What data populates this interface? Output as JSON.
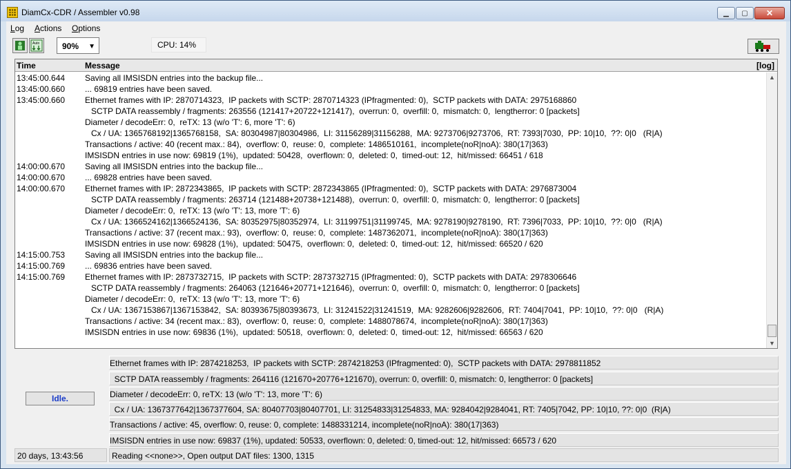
{
  "window": {
    "title": "DiamCx-CDR / Assembler  v0.98"
  },
  "menu": {
    "items": [
      "Log",
      "Actions",
      "Options"
    ]
  },
  "toolbar": {
    "zoom": "90%",
    "cpu": "CPU: 14%"
  },
  "log": {
    "headers": {
      "time": "Time",
      "message": "Message",
      "log": "[log]"
    },
    "lines": [
      {
        "time": "13:45:00.644",
        "msg": "Saving all IMSISDN entries into the backup file...",
        "indent": false
      },
      {
        "time": "13:45:00.660",
        "msg": "... 69819 entries have been saved.",
        "indent": false
      },
      {
        "time": "13:45:00.660",
        "msg": "Ethernet frames with IP: 2870714323,  IP packets with SCTP: 2870714323 (IPfragmented: 0),  SCTP packets with DATA: 2975168860",
        "indent": false
      },
      {
        "time": "",
        "msg": "SCTP DATA reassembly / fragments: 263556 (121417+20722+121417),  overrun: 0,  overfill: 0,  mismatch: 0,  lengtherror: 0 [packets]",
        "indent": true
      },
      {
        "time": "",
        "msg": "Diameter / decodeErr: 0,  reTX: 13 (w/o 'T': 6, more 'T': 6)",
        "indent": false
      },
      {
        "time": "",
        "msg": "Cx / UA: 1365768192|1365768158,  SA: 80304987|80304986,  LI: 31156289|31156288,  MA: 9273706|9273706,  RT: 7393|7030,  PP: 10|10,  ??: 0|0   (R|A)",
        "indent": true
      },
      {
        "time": "",
        "msg": "Transactions / active: 40 (recent max.: 84),  overflow: 0,  reuse: 0,  complete: 1486510161,  incomplete(noR|noA): 380(17|363)",
        "indent": false
      },
      {
        "time": "",
        "msg": "IMSISDN entries in use now: 69819 (1%),  updated: 50428,  overflown: 0,  deleted: 0,  timed-out: 12,  hit/missed: 66451 / 618",
        "indent": false
      },
      {
        "time": "14:00:00.670",
        "msg": "Saving all IMSISDN entries into the backup file...",
        "indent": false
      },
      {
        "time": "14:00:00.670",
        "msg": "... 69828 entries have been saved.",
        "indent": false
      },
      {
        "time": "14:00:00.670",
        "msg": "Ethernet frames with IP: 2872343865,  IP packets with SCTP: 2872343865 (IPfragmented: 0),  SCTP packets with DATA: 2976873004",
        "indent": false
      },
      {
        "time": "",
        "msg": "SCTP DATA reassembly / fragments: 263714 (121488+20738+121488),  overrun: 0,  overfill: 0,  mismatch: 0,  lengtherror: 0 [packets]",
        "indent": true
      },
      {
        "time": "",
        "msg": "Diameter / decodeErr: 0,  reTX: 13 (w/o 'T': 13, more 'T': 6)",
        "indent": false
      },
      {
        "time": "",
        "msg": "Cx / UA: 1366524162|1366524136,  SA: 80352975|80352974,  LI: 31199751|31199745,  MA: 9278190|9278190,  RT: 7396|7033,  PP: 10|10,  ??: 0|0   (R|A)",
        "indent": true
      },
      {
        "time": "",
        "msg": "Transactions / active: 37 (recent max.: 93),  overflow: 0,  reuse: 0,  complete: 1487362071,  incomplete(noR|noA): 380(17|363)",
        "indent": false
      },
      {
        "time": "",
        "msg": "IMSISDN entries in use now: 69828 (1%),  updated: 50475,  overflown: 0,  deleted: 0,  timed-out: 12,  hit/missed: 66520 / 620",
        "indent": false
      },
      {
        "time": "14:15:00.753",
        "msg": "Saving all IMSISDN entries into the backup file...",
        "indent": false
      },
      {
        "time": "14:15:00.769",
        "msg": "... 69836 entries have been saved.",
        "indent": false
      },
      {
        "time": "14:15:00.769",
        "msg": "Ethernet frames with IP: 2873732715,  IP packets with SCTP: 2873732715 (IPfragmented: 0),  SCTP packets with DATA: 2978306646",
        "indent": false
      },
      {
        "time": "",
        "msg": "SCTP DATA reassembly / fragments: 264063 (121646+20771+121646),  overrun: 0,  overfill: 0,  mismatch: 0,  lengtherror: 0 [packets]",
        "indent": true
      },
      {
        "time": "",
        "msg": "Diameter / decodeErr: 0,  reTX: 13 (w/o 'T': 13, more 'T': 6)",
        "indent": false
      },
      {
        "time": "",
        "msg": "Cx / UA: 1367153867|1367153842,  SA: 80393675|80393673,  LI: 31241522|31241519,  MA: 9282606|9282606,  RT: 7404|7041,  PP: 10|10,  ??: 0|0   (R|A)",
        "indent": true
      },
      {
        "time": "",
        "msg": "Transactions / active: 34 (recent max.: 83),  overflow: 0,  reuse: 0,  complete: 1488078674,  incomplete(noR|noA): 380(17|363)",
        "indent": false
      },
      {
        "time": "",
        "msg": "IMSISDN entries in use now: 69836 (1%),  updated: 50518,  overflown: 0,  deleted: 0,  timed-out: 12,  hit/missed: 66563 / 620",
        "indent": false
      }
    ]
  },
  "status": {
    "idle": "Idle.",
    "stats": [
      "Ethernet frames with IP: 2874218253,  IP packets with SCTP: 2874218253 (IPfragmented: 0),  SCTP packets with DATA: 2978811852",
      "  SCTP DATA reassembly / fragments: 264116 (121670+20776+121670), overrun: 0, overfill: 0, mismatch: 0, lengtherror: 0 [packets]",
      "Diameter / decodeErr: 0, reTX: 13 (w/o 'T': 13, more 'T': 6)",
      "  Cx / UA: 1367377642|1367377604, SA: 80407703|80407701, LI: 31254833|31254833, MA: 9284042|9284041, RT: 7405|7042, PP: 10|10, ??: 0|0  (R|A)",
      "Transactions / active: 45, overflow: 0, reuse: 0, complete: 1488331214, incomplete(noR|noA): 380(17|363)",
      "IMSISDN entries in use now: 69837 (1%), updated: 50533, overflown: 0, deleted: 0, timed-out: 12, hit/missed: 66573 / 620"
    ],
    "uptime": "20 days, 13:43:56",
    "footer": "Reading <<none>>,  Open output DAT files: 1300, 1315"
  }
}
